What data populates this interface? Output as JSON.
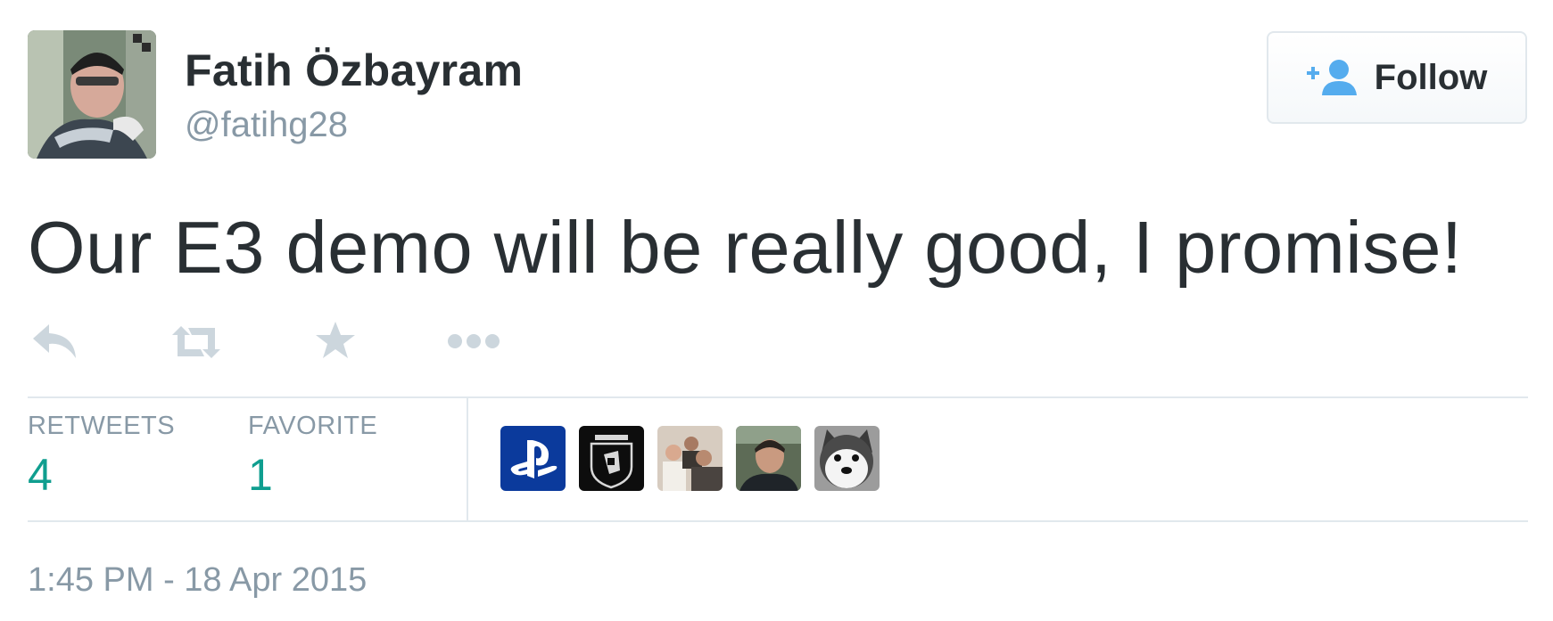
{
  "tweet": {
    "author": {
      "display_name": "Fatih Özbayram",
      "screen_name": "@fatihg28",
      "avatar_icon": "user-avatar-photo"
    },
    "follow_button": {
      "label": "Follow",
      "icon": "add-user-icon"
    },
    "text": "Our E3 demo will be really good, I promise!",
    "actions": [
      {
        "name": "reply",
        "icon": "reply-icon"
      },
      {
        "name": "retweet",
        "icon": "retweet-icon"
      },
      {
        "name": "favorite",
        "icon": "star-icon"
      },
      {
        "name": "more",
        "icon": "ellipsis-icon"
      }
    ],
    "stats": {
      "retweets_label": "RETWEETS",
      "retweets_count": "4",
      "favorites_label": "FAVORITE",
      "favorites_count": "1"
    },
    "favoriter_avatars": [
      {
        "icon": "playstation-logo-avatar"
      },
      {
        "icon": "teyyubov-badge-avatar"
      },
      {
        "icon": "group-photo-avatar"
      },
      {
        "icon": "person-photo-avatar"
      },
      {
        "icon": "husky-plush-avatar"
      }
    ],
    "timestamp": "1:45 PM - 18 Apr 2015"
  },
  "colors": {
    "text": "#292f33",
    "muted": "#8899a6",
    "stat_value": "#0f9e8f",
    "divider": "#e1e8ed",
    "action_icon": "#ccd6dd",
    "follow_icon": "#55acee"
  }
}
